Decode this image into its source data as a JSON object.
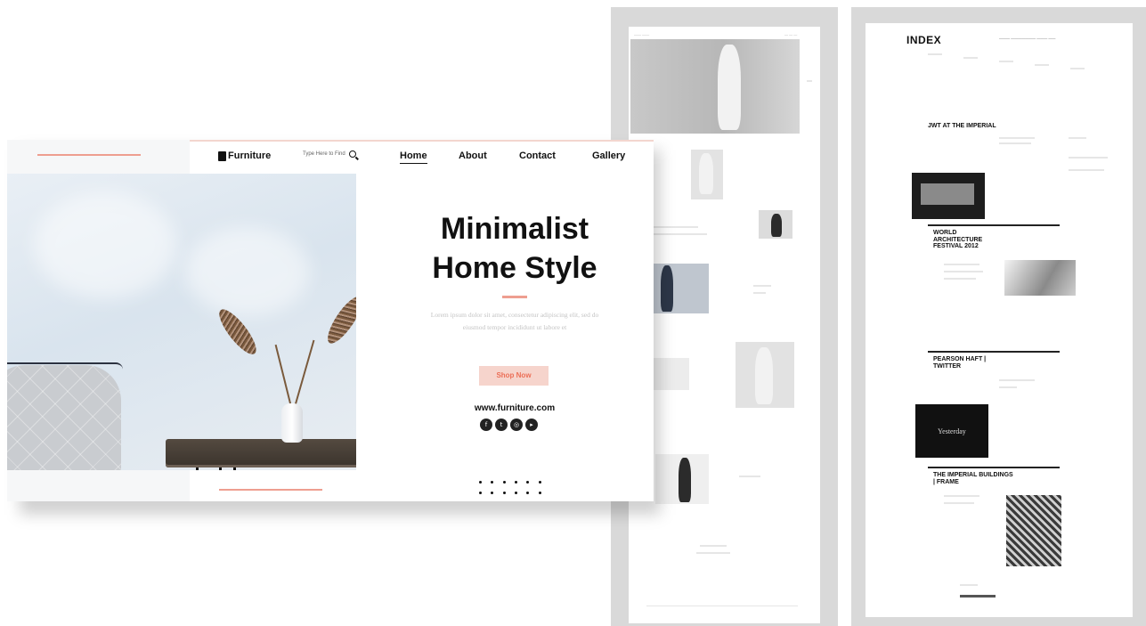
{
  "main_mockup": {
    "brand": "Furniture",
    "search_placeholder": "Type Here to Find",
    "nav": [
      {
        "label": "Home",
        "active": true
      },
      {
        "label": "About",
        "active": false
      },
      {
        "label": "Contact",
        "active": false
      },
      {
        "label": "Gallery",
        "active": false
      }
    ],
    "headline_line1": "Minimalist",
    "headline_line2": "Home Style",
    "body_text": "Lorem ipsum dolor sit amet, consectetur adipiscing elit, sed do eiusmod tempor incididunt ut labore et",
    "cta_label": "Shop Now",
    "website": "www.furniture.com",
    "social_icons": [
      "facebook-icon",
      "twitter-icon",
      "instagram-icon",
      "youtube-icon"
    ],
    "accent_color": "#ee9e90",
    "cta_text_color": "#ec6f57"
  },
  "index_mockup": {
    "logo": "INDEX",
    "sections": [
      "JWT AT THE IMPERIAL",
      "WORLD ARCHITECTURE FESTIVAL 2012",
      "PEARSON HAFT | TWITTER",
      "THE IMPERIAL BUILDINGS | FRAME"
    ],
    "dark_box_text": "Yesterday"
  }
}
